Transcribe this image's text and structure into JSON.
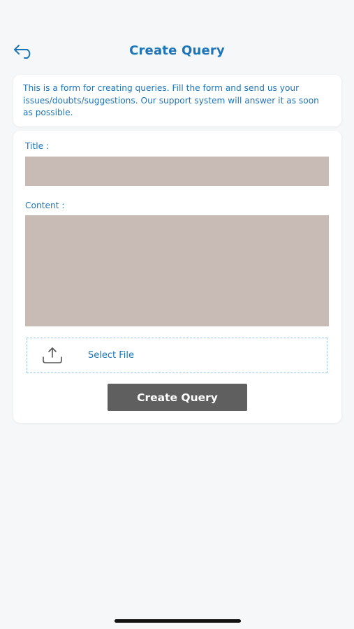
{
  "header": {
    "title": "Create Query",
    "back_icon": "back-arrow-icon"
  },
  "info": {
    "text": "This is a form for creating queries. Fill the form and send us your issues/doubts/suggestions. Our support system will answer it as soon as possible."
  },
  "form": {
    "title_label": "Title :",
    "title_value": "",
    "content_label": "Content :",
    "content_value": "",
    "upload_icon": "upload-icon",
    "select_file_label": "Select File",
    "submit_label": "Create Query"
  },
  "colors": {
    "accent": "#1d74b8",
    "input_background": "#c8bab5",
    "button_background": "#5f5f5f",
    "page_background": "#f6f7f9",
    "dashed_border": "#9cc6e8"
  }
}
